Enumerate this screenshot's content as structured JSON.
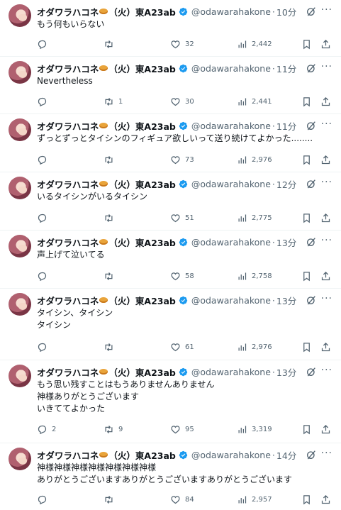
{
  "author": {
    "display_name": "オダワラハコネ",
    "suffix": "（火）東A23ab",
    "handle": "@odawarahakone"
  },
  "colors": {
    "text": "#0f1419",
    "muted": "#536471",
    "verified": "#1d9bf0",
    "divider": "#eff3f4"
  },
  "icons": [
    "reply-icon",
    "retweet-icon",
    "like-icon",
    "views-icon",
    "bookmark-icon",
    "share-icon",
    "grok-icon",
    "more-icon",
    "verified-badge-icon"
  ],
  "tweets": [
    {
      "time": "10分",
      "lines": [
        "もう何もいらない"
      ],
      "replies": "",
      "retweets": "",
      "likes": "32",
      "views": "2,442"
    },
    {
      "time": "11分",
      "lines": [
        "Nevertheless"
      ],
      "replies": "",
      "retweets": "1",
      "likes": "30",
      "views": "2,441"
    },
    {
      "time": "11分",
      "lines": [
        "ずっとずっとタイシンのフィギュア欲しいって送り続けてよかった........"
      ],
      "replies": "",
      "retweets": "",
      "likes": "73",
      "views": "2,976"
    },
    {
      "time": "12分",
      "lines": [
        "いるタイシンがいるタイシン"
      ],
      "replies": "",
      "retweets": "",
      "likes": "51",
      "views": "2,775"
    },
    {
      "time": "13分",
      "lines": [
        "声上げて泣いてる"
      ],
      "replies": "",
      "retweets": "",
      "likes": "58",
      "views": "2,758"
    },
    {
      "time": "13分",
      "lines": [
        "タイシン、タイシン",
        "タイシン"
      ],
      "replies": "",
      "retweets": "",
      "likes": "61",
      "views": "2,976"
    },
    {
      "time": "13分",
      "lines": [
        "もう思い残すことはもうありませんありません",
        "神様ありがとうございます",
        "いきててよかった"
      ],
      "replies": "2",
      "retweets": "9",
      "likes": "95",
      "views": "3,319"
    },
    {
      "time": "14分",
      "lines": [
        "神様神様神様神様神様神様神様",
        "ありがとうございますありがとうございますありがとうございます"
      ],
      "replies": "",
      "retweets": "",
      "likes": "84",
      "views": "2,957"
    }
  ]
}
